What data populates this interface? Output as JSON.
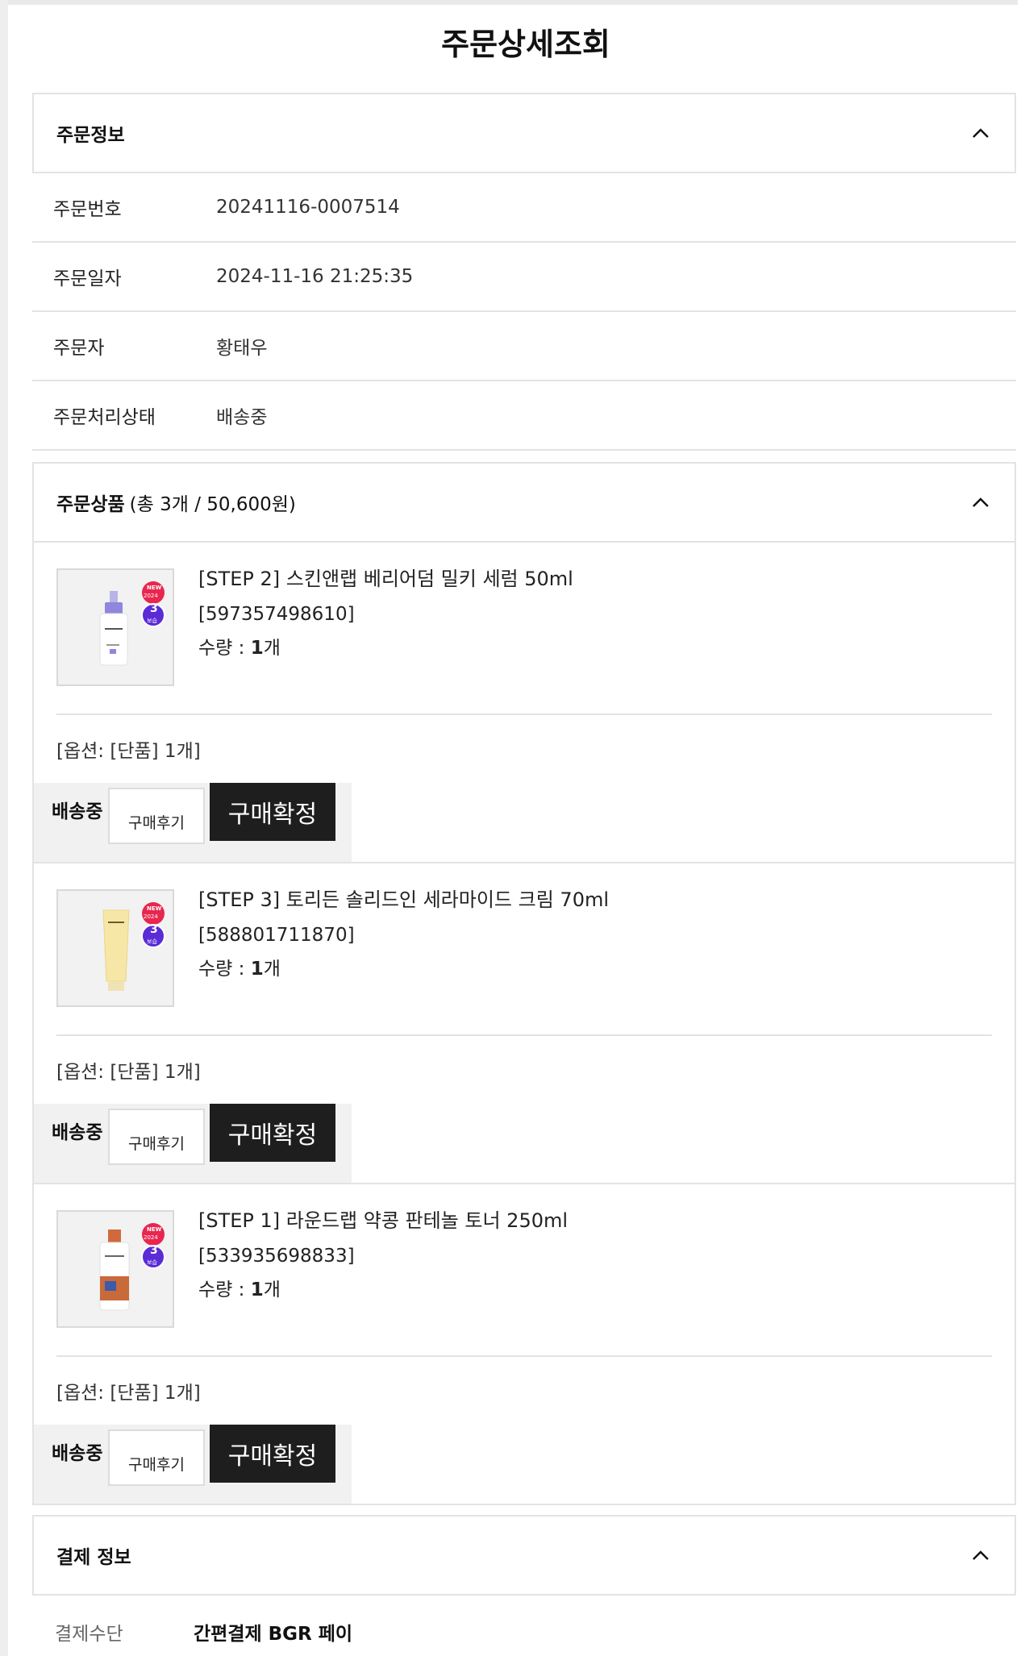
{
  "page": {
    "title": "주문상세조회"
  },
  "order_info": {
    "title": "주문정보",
    "rows": [
      {
        "label": "주문번호",
        "value": "20241116-0007514"
      },
      {
        "label": "주문일자",
        "value": "2024-11-16 21:25:35"
      },
      {
        "label": "주문자",
        "value": "황태우"
      },
      {
        "label": "주문처리상태",
        "value": "배송중"
      }
    ]
  },
  "order_items": {
    "title": "주문상품",
    "summary": "(총 3개 / 50,600원)",
    "qty_label": "수량 : ",
    "items": [
      {
        "name": "[STEP 2] 스킨앤랩 베리어덤 밀키 세럼 50ml",
        "code": "[597357498610]",
        "qty": "1",
        "qty_unit": "개",
        "option": "[옵션: [단품] 1개]",
        "status": "배송중",
        "review_label": "구매후기",
        "confirm_label": "구매확정",
        "badge_top": "NEW",
        "badge_year": "2024",
        "badge_num": "3",
        "badge_sub": "보습"
      },
      {
        "name": "[STEP 3] 토리든 솔리드인 세라마이드 크림 70ml",
        "code": "[588801711870]",
        "qty": "1",
        "qty_unit": "개",
        "option": "[옵션: [단품] 1개]",
        "status": "배송중",
        "review_label": "구매후기",
        "confirm_label": "구매확정",
        "badge_top": "NEW",
        "badge_year": "2024",
        "badge_num": "3",
        "badge_sub": "보습"
      },
      {
        "name": "[STEP 1] 라운드랩 약콩 판테놀 토너 250ml",
        "code": "[533935698833]",
        "qty": "1",
        "qty_unit": "개",
        "option": "[옵션: [단품] 1개]",
        "status": "배송중",
        "review_label": "구매후기",
        "confirm_label": "구매확정",
        "badge_top": "NEW",
        "badge_year": "2024",
        "badge_num": "3",
        "badge_sub": "보습"
      }
    ]
  },
  "payment": {
    "title": "결제 정보",
    "method_label": "결제수단",
    "method_value": "간편결제 BGR 페이"
  },
  "colors": {
    "confirm_button_bg": "#1e1e1e",
    "border": "#e3e3e3",
    "action_bar_bg": "#f1f1f1",
    "badge_red": "#e8264f",
    "badge_purple": "#5b2bd6"
  },
  "icons": {
    "collapse": "chevron-up-icon"
  }
}
